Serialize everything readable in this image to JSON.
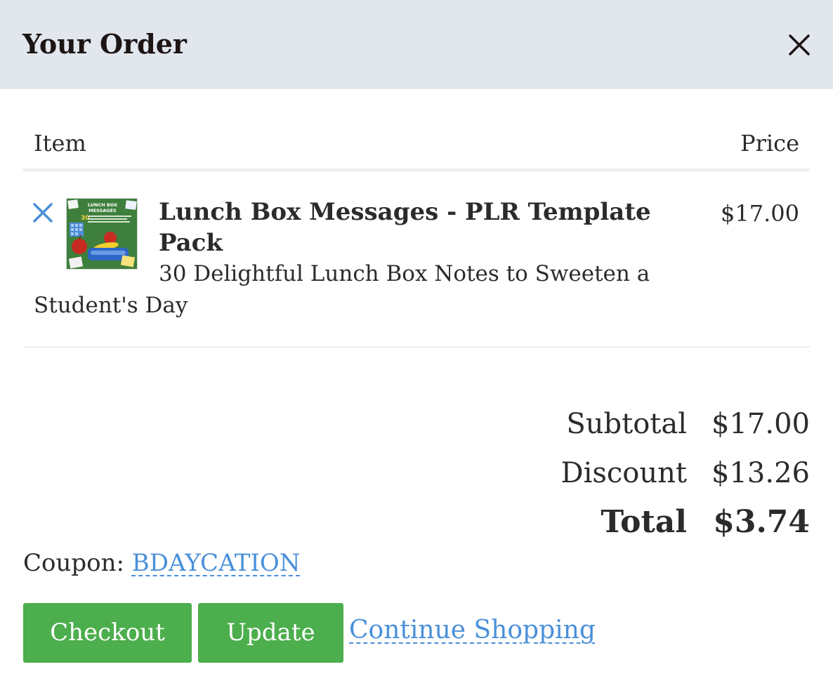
{
  "header": {
    "title": "Your Order",
    "close_icon": "close-icon"
  },
  "table": {
    "columns": [
      "Item",
      "Price"
    ]
  },
  "items": [
    {
      "remove_icon": "remove-x-icon",
      "thumbnail_text": "LUNCH BOX MESSAGES",
      "name": "Lunch Box Messages - PLR Template Pack",
      "description": "30 Delightful Lunch Box Notes to Sweeten a Student's Day",
      "price": "$17.00"
    }
  ],
  "summary": {
    "subtotal_label": "Subtotal",
    "subtotal": "$17.00",
    "discount_label": "Discount",
    "discount": "$13.26",
    "total_label": "Total",
    "total": "$3.74"
  },
  "coupon": {
    "label": "Coupon:",
    "code": "BDAYCATION"
  },
  "actions": {
    "checkout": "Checkout",
    "update": "Update",
    "continue": "Continue Shopping"
  },
  "colors": {
    "header_bg": "#e2e7ee",
    "button_green": "#4cae4c",
    "link_blue": "#4a90d9"
  }
}
